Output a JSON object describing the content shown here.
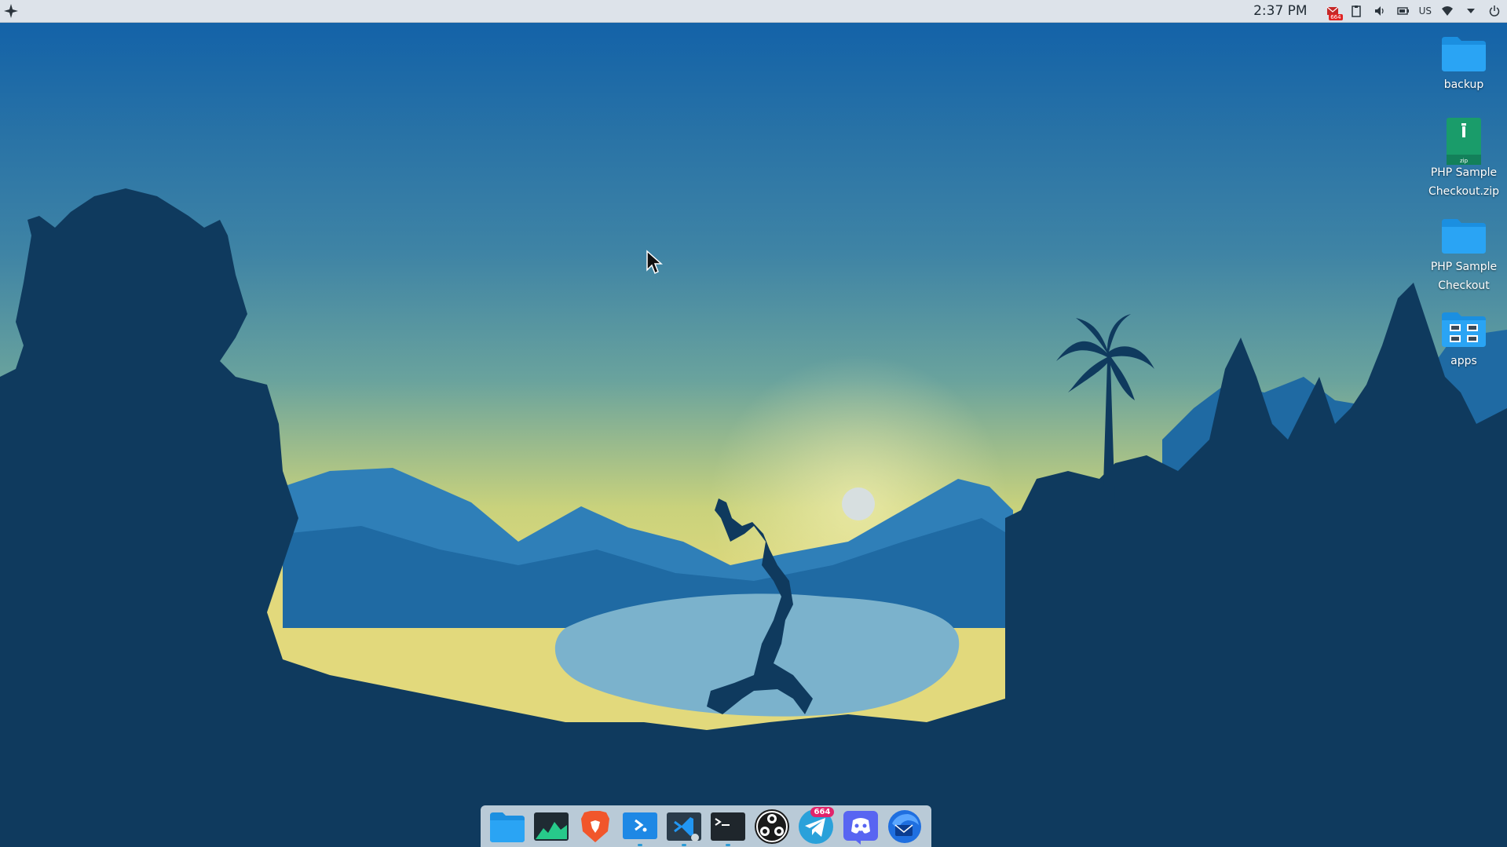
{
  "panel": {
    "clock": "2:37 PM",
    "keyboard_layout": "US",
    "mail_badge": "664",
    "icons": [
      "app-menu-icon",
      "mail-icon",
      "clipboard-icon",
      "volume-icon",
      "battery-icon",
      "wifi-icon",
      "dropdown-icon",
      "power-icon"
    ]
  },
  "desktop": {
    "icons": [
      {
        "label": "backup",
        "type": "folder"
      },
      {
        "label": "PHP Sample Checkout.zip",
        "type": "zip"
      },
      {
        "label": "PHP Sample Checkout",
        "type": "folder"
      },
      {
        "label": "apps",
        "type": "folder-apps"
      }
    ]
  },
  "dock": {
    "items": [
      {
        "app": "Files",
        "icon": "folder-icon"
      },
      {
        "app": "System Monitor",
        "icon": "system-monitor-icon"
      },
      {
        "app": "Brave",
        "icon": "brave-icon"
      },
      {
        "app": "Remote Desktop",
        "icon": "remote-desktop-icon"
      },
      {
        "app": "Visual Studio Code",
        "icon": "vscode-icon"
      },
      {
        "app": "Terminal",
        "icon": "terminal-icon"
      },
      {
        "app": "OBS Studio",
        "icon": "obs-icon"
      },
      {
        "app": "Telegram",
        "icon": "telegram-icon",
        "badge": "664"
      },
      {
        "app": "Discord",
        "icon": "discord-icon"
      },
      {
        "app": "Thunderbird",
        "icon": "thunderbird-icon"
      }
    ]
  },
  "colors": {
    "sky_top": "#0f5fa8",
    "sky_mid": "#5f9ea6",
    "horizon": "#d8d679",
    "silhouette": "#0f3a5e",
    "panel_bg": "#dde3ea",
    "dock_bg": "#d2dee8",
    "folder_blue": "#2aa4f4",
    "badge_pink": "#e2246b"
  }
}
